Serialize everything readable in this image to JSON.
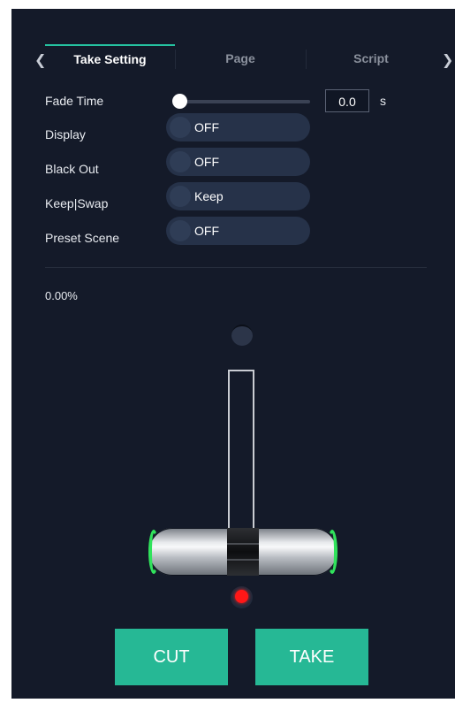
{
  "tabs": {
    "items": [
      {
        "label": "Take Setting",
        "active": true
      },
      {
        "label": "Page",
        "active": false
      },
      {
        "label": "Script",
        "active": false
      }
    ],
    "prev_icon": "chevron-left-icon",
    "next_icon": "chevron-right-icon"
  },
  "settings": {
    "fade_time": {
      "label": "Fade Time",
      "value": "0.0",
      "unit": "s",
      "slider_fraction": 0.0
    },
    "display": {
      "label": "Display",
      "value": "OFF"
    },
    "black_out": {
      "label": "Black Out",
      "value": "OFF"
    },
    "keep_swap": {
      "label": "Keep|Swap",
      "value": "Keep"
    },
    "preset_scene": {
      "label": "Preset Scene",
      "value": "OFF"
    }
  },
  "fader": {
    "percent_text": "0.00%",
    "position_fraction": 0.0,
    "cap_color": "#31e35c",
    "indicator_color": "#ff1717"
  },
  "buttons": {
    "cut": "CUT",
    "take": "TAKE"
  },
  "colors": {
    "background": "#141a29",
    "accent": "#26b895",
    "toggle_bg": "#263249"
  }
}
